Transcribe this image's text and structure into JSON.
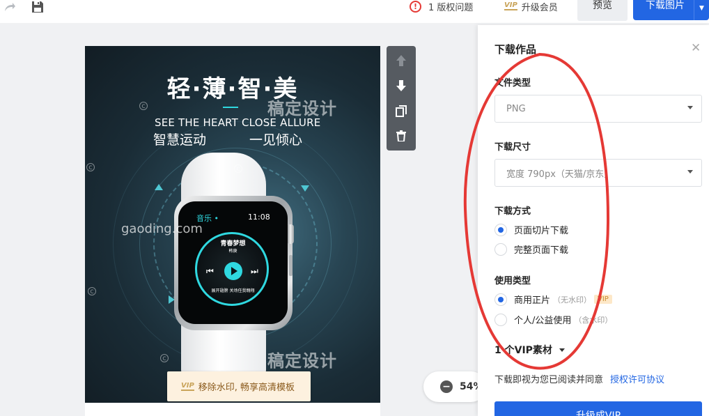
{
  "topbar": {
    "redo_icon": "redo-icon",
    "save_icon": "save-icon",
    "copyright_count": "1 版权问题",
    "vip_upgrade": "升级会员",
    "preview": "预览",
    "download": "下载图片"
  },
  "poster": {
    "headline": "轻·薄·智·美",
    "subtitle_en": "SEE THE HEART  CLOSE ALLURE",
    "subtitle_cn_1": "智慧运动",
    "subtitle_cn_2": "一见倾心",
    "watermark_cn": "稿定设计",
    "watermark_en": "gaoding.com",
    "watch": {
      "app_label": "音乐 •",
      "time": "11:08",
      "song": "青春梦想",
      "artist": "韩庚",
      "lyric": "展开翅膀 关场任我翱翔"
    },
    "banner_text": "移除水印, 畅享高清模板"
  },
  "float_tools": [
    "move-up-icon",
    "move-down-icon",
    "duplicate-icon",
    "delete-icon"
  ],
  "zoom": {
    "value": "54%"
  },
  "panel": {
    "title": "下载作品",
    "file_type_label": "文件类型",
    "file_type_value": "PNG",
    "size_label": "下载尺寸",
    "size_value": "宽度 790px（天猫/京东）",
    "method_label": "下载方式",
    "method_options": [
      "页面切片下载",
      "完整页面下载"
    ],
    "method_selected": 0,
    "usage_label": "使用类型",
    "usage_options": [
      {
        "label": "商用正片",
        "note": "（无水印）",
        "badge": "VIP"
      },
      {
        "label": "个人/公益使用",
        "note": "（含水印）"
      }
    ],
    "usage_selected": 0,
    "vip_count": "1 个VIP素材",
    "agree_text": "下载即视为您已阅读并同意",
    "agree_link": "授权许可协议",
    "upgrade_button": "升级成VIP"
  },
  "colors": {
    "accent": "#2266e3",
    "poster_accent": "#2fd8e0",
    "annotation": "#e53935"
  }
}
